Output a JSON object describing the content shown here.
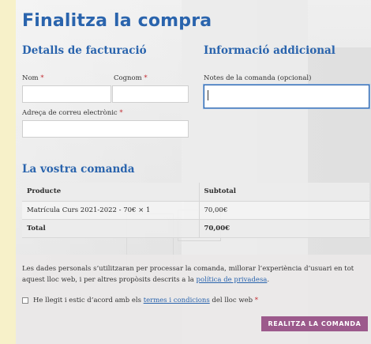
{
  "page": {
    "title": "Finalitza la compra"
  },
  "billing": {
    "heading": "Detalls de facturació",
    "first_name_label": "Nom",
    "last_name_label": "Cognom",
    "email_label": "Adreça de correu electrònic",
    "required_mark": "*",
    "first_name_value": "",
    "last_name_value": "",
    "email_value": ""
  },
  "additional": {
    "heading": "Informació addicional",
    "notes_label": "Notes de la comanda (opcional)",
    "notes_value": ""
  },
  "order": {
    "heading": "La vostra comanda",
    "columns": [
      "Producte",
      "Subtotal"
    ],
    "items": [
      {
        "product": "Matrícula Curs 2021-2022 - 70€ × 1",
        "subtotal": "70,00€"
      }
    ],
    "total_label": "Total",
    "total_value": "70,00€"
  },
  "payment": {
    "privacy_text": "Les dades personals s’utilitzaran per processar la comanda, millorar l’experiència d’usuari en tot aquest lloc web, i per altres propòsits descrits a la",
    "privacy_link": "política de privadesa",
    "privacy_end": ".",
    "terms_text": "He llegit i estic d’acord amb els",
    "terms_link": "termes i condicions",
    "terms_end": "del lloc web",
    "terms_required": "*",
    "place_order_label": "REALITZA LA COMANDA",
    "button_color": "#9c5a8c"
  },
  "colors": {
    "heading": "#2a64ad",
    "background": "#f7f1c9"
  }
}
